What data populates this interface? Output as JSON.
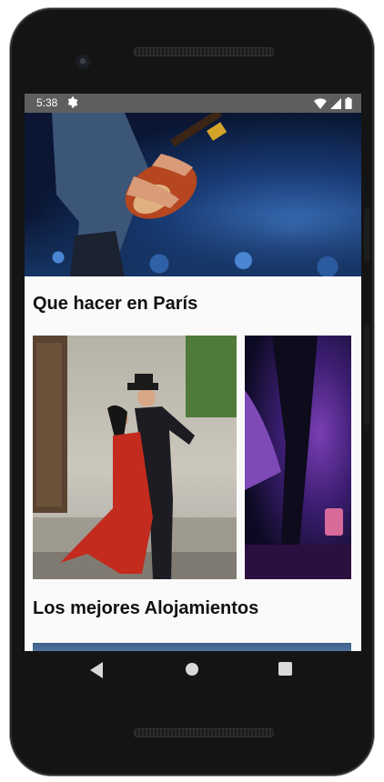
{
  "status_bar": {
    "time": "5:38",
    "icons": [
      "settings-icon",
      "wifi-icon",
      "signal-icon",
      "battery-icon"
    ]
  },
  "sections": [
    {
      "title": "Que hacer en París"
    },
    {
      "title": "Los mejores Alojamientos"
    }
  ],
  "nav": {
    "buttons": [
      "back-icon",
      "home-icon",
      "recents-icon"
    ]
  },
  "colors": {
    "status_bar": "#5e5e5e",
    "screen_bg": "#fafafa",
    "device": "#141414"
  }
}
